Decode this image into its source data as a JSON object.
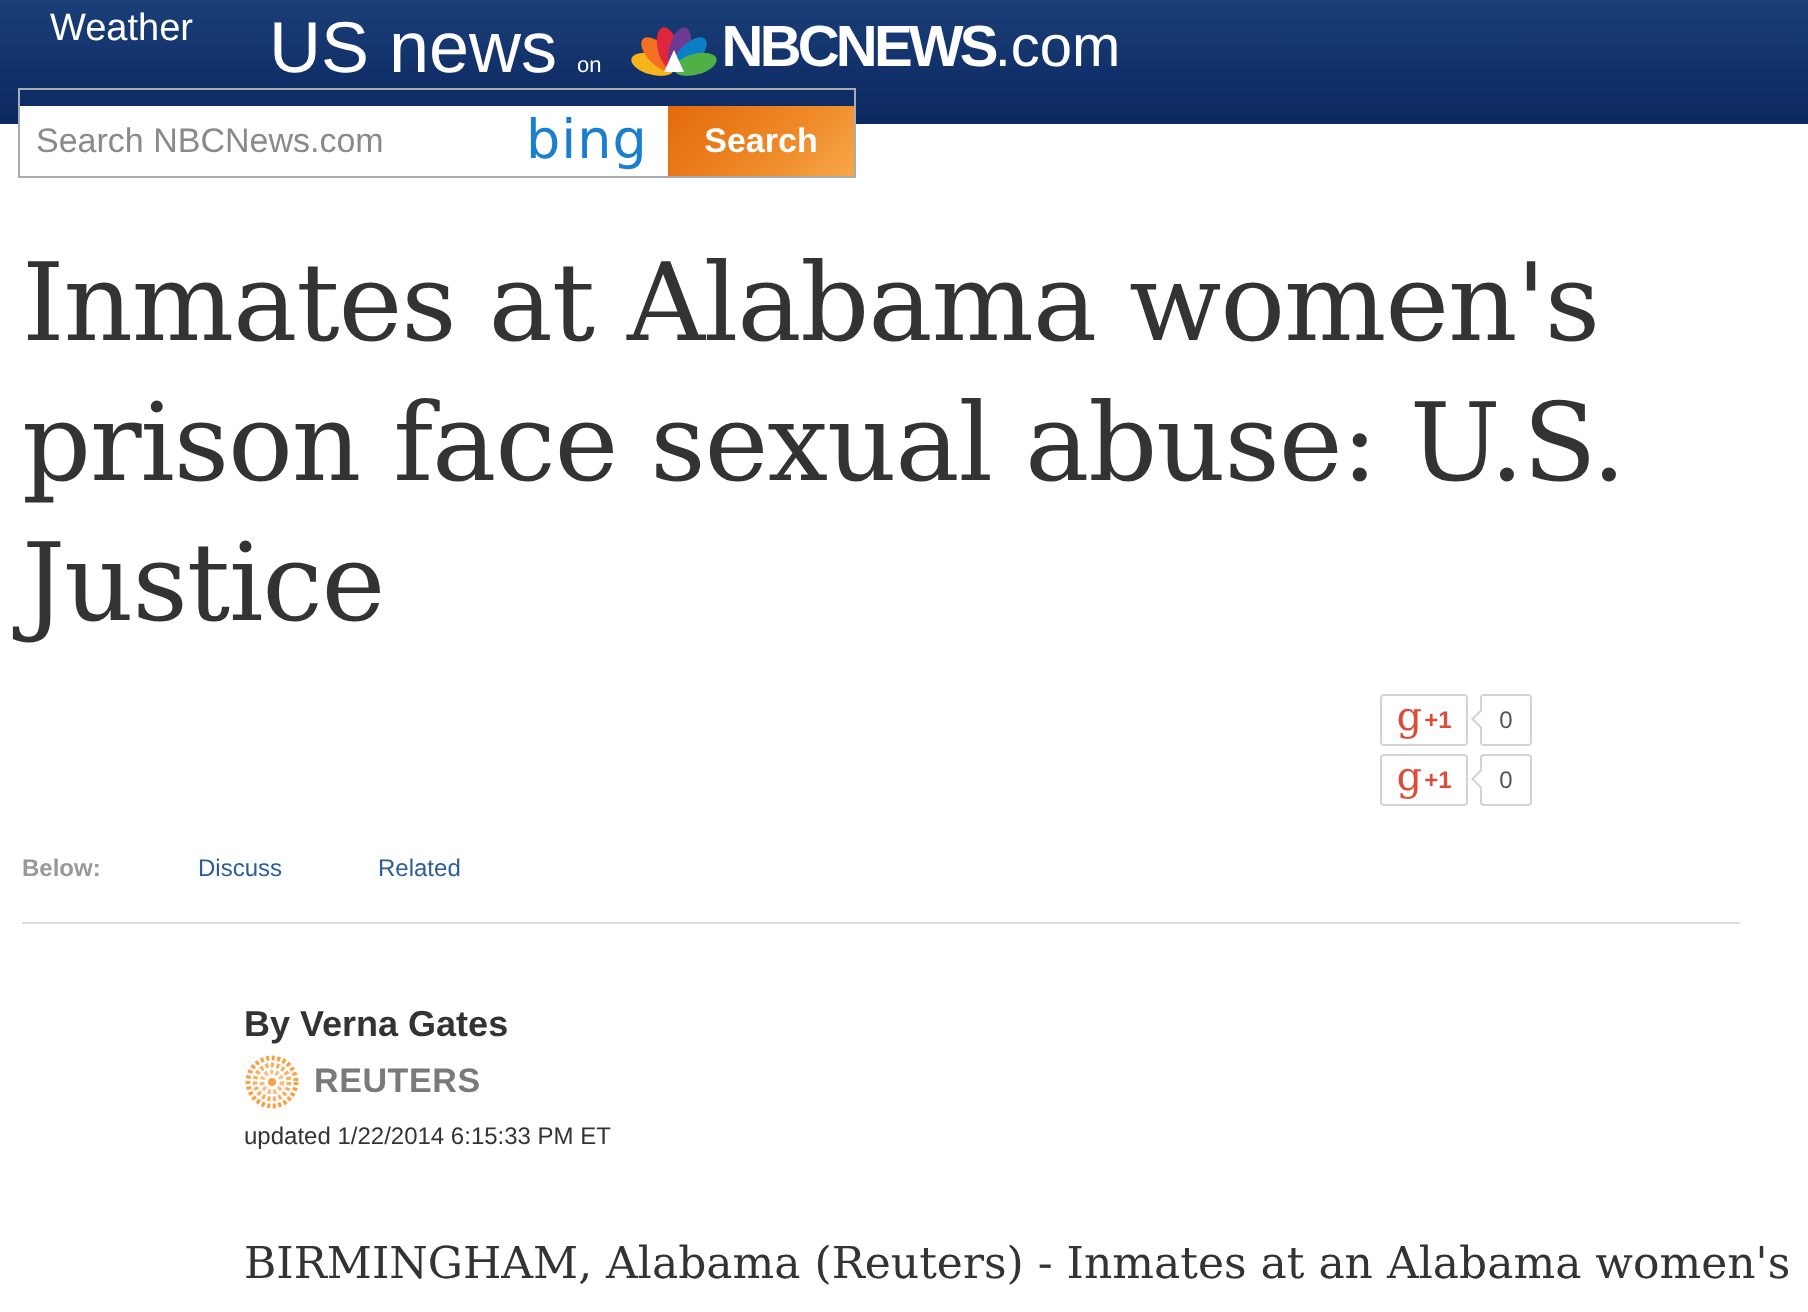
{
  "header": {
    "links": [
      {
        "label": "Weather"
      }
    ],
    "section_title": "US news",
    "on_label": "on",
    "logo_text": "NBCNEWS",
    "logo_suffix": ".com"
  },
  "search": {
    "placeholder": "Search NBCNews.com",
    "provider": "bing",
    "button": "Search"
  },
  "headline": "Inmates at Alabama women's prison face sexual abuse: U.S. Justice",
  "plus_one": [
    {
      "mark": "g",
      "label": "+1",
      "count": "0"
    },
    {
      "mark": "g",
      "label": "+1",
      "count": "0"
    }
  ],
  "below_nav": {
    "label": "Below:",
    "links": [
      {
        "label": "Discuss"
      },
      {
        "label": "Related"
      }
    ]
  },
  "article": {
    "byline": "By Verna Gates",
    "source": "REUTERS",
    "updated": "updated 1/22/2014 6:15:33 PM ET",
    "body": "BIRMINGHAM, Alabama (Reuters) - Inmates at an Alabama women's"
  }
}
